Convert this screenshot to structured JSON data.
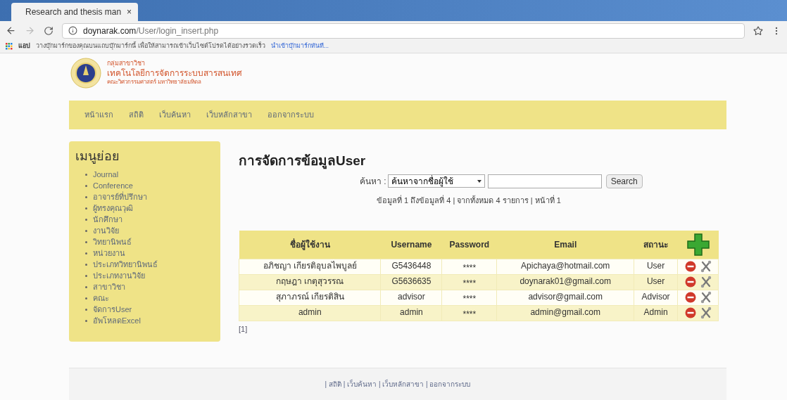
{
  "browser": {
    "tab_title": "Research and thesis man",
    "tab_close": "×",
    "url_host": "doynarak.com",
    "url_path": "/User/login_insert.php",
    "apps_label": "แอป",
    "bookmarks_hint": "วางบุ๊กมาร์กของคุณบนแถบบุ๊กมาร์กนี้ เพื่อให้สามารถเข้าเว็บไซต์โปรดได้อย่างรวดเร็ว",
    "bookmarks_link": "นำเข้าบุ๊กมาร์กทันที..."
  },
  "logo": {
    "lines": [
      "กลุ่มสาขาวิชา",
      "เทคโนโลยีการจัดการระบบสารสนเทศ",
      "คณะวิศวกรรมศาสตร์ มหาวิทยาลัยมหิดล"
    ]
  },
  "nav": [
    "หน้าแรก",
    "สถิติ",
    "เว็บค้นหา",
    "เว็บหลักสาขา",
    "ออกจากระบบ"
  ],
  "sidebar": {
    "title": "เมนูย่อย",
    "items": [
      "Journal",
      "Conference",
      "อาจารย์ที่ปรึกษา",
      "ผู้ทรงคุณวุฒิ",
      "นักศึกษา",
      "งานวิจัย",
      "วิทยานิพนธ์",
      "หน่วยงาน",
      "ประเภทวิทยานิพนธ์",
      "ประเภทงานวิจัย",
      "สาขาวิชา",
      "คณะ",
      "จัดการUser",
      "อัพโหลดExcel"
    ]
  },
  "main": {
    "title": "การจัดการข้อมูลUser",
    "search": {
      "label": "ค้นหา :",
      "select_value": "ค้นหาจากชื่อผู้ใช้",
      "button": "Search"
    },
    "info": "ข้อมูลที่ 1 ถึงข้อมูลที่ 4 | จากทั้งหมด 4 รายการ | หน้าที่ 1",
    "table": {
      "columns": [
        "ชื่อผู้ใช้งาน",
        "Username",
        "Password",
        "Email",
        "สถานะ"
      ],
      "rows": [
        {
          "name": "อภิชญา เกียรติอุบลไพบูลย์",
          "username": "G5436448",
          "password": "****",
          "email": "Apichaya@hotmail.com",
          "status": "User"
        },
        {
          "name": "กฤษฎา เกตุสุวรรณ",
          "username": "G5636635",
          "password": "****",
          "email": "doynarak01@gmail.com",
          "status": "User"
        },
        {
          "name": "สุภาภรณ์ เกียรติสิน",
          "username": "advisor",
          "password": "****",
          "email": "advisor@gmail.com",
          "status": "Advisor"
        },
        {
          "name": "admin",
          "username": "admin",
          "password": "****",
          "email": "admin@gmail.com",
          "status": "Admin"
        }
      ]
    },
    "pagination": "[1]"
  },
  "footer": "| สถิติ | เว็บค้นหา | เว็บหลักสาขา | ออกจากระบบ"
}
